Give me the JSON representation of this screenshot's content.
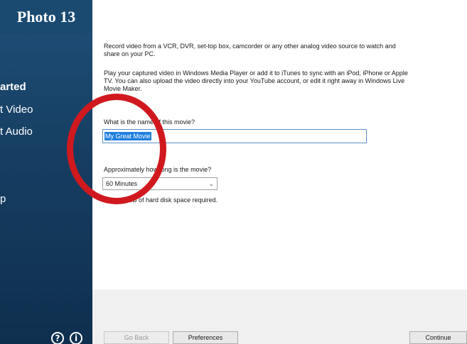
{
  "photo_label": "Photo 13",
  "sidebar": {
    "items": [
      {
        "label": "arted",
        "active": true
      },
      {
        "label": "t Video",
        "active": false
      },
      {
        "label": "t Audio",
        "active": false
      },
      {
        "label": "p",
        "active": false
      }
    ],
    "help_icon": "?",
    "info_icon": "i"
  },
  "content": {
    "intro1": "Record video from a VCR, DVR, set-top box, camcorder or any other analog video source to watch and share on your PC.",
    "intro2": "Play your captured video in Windows Media Player or add it to iTunes to sync with an iPod, iPhone or Apple TV. You can also upload the video directly into your YouTube account, or edit it right away in Windows Live Movie Maker.",
    "name_question": "What is the name of this movie?",
    "name_value": "My Great Movie",
    "length_question": "Approximately how long is the movie?",
    "length_value": "60 Minutes",
    "disk_note": "About 1 GB of hard disk space required."
  },
  "footer": {
    "go_back": "Go Back",
    "preferences": "Preferences",
    "continue": "Continue"
  },
  "colors": {
    "sidebar": "#163e62",
    "overlay_circle": "#d0191f",
    "selection": "#1f7fe0"
  }
}
